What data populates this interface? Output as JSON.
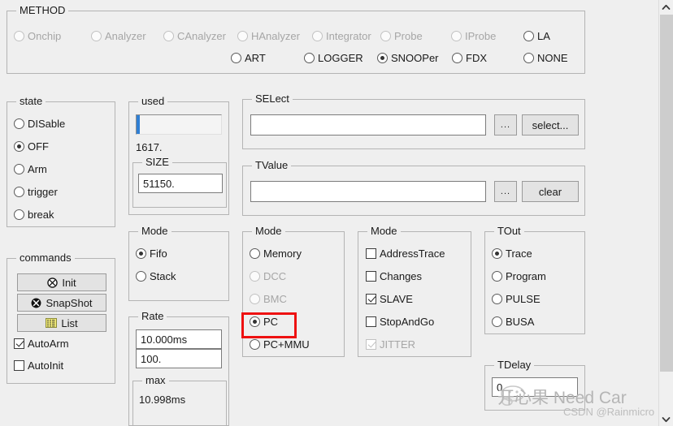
{
  "method": {
    "legend": "METHOD",
    "row1": [
      {
        "label": "Onchip",
        "checked": false,
        "disabled": true
      },
      {
        "label": "Analyzer",
        "checked": false,
        "disabled": true
      },
      {
        "label": "CAnalyzer",
        "checked": false,
        "disabled": true
      },
      {
        "label": "HAnalyzer",
        "checked": false,
        "disabled": true
      },
      {
        "label": "Integrator",
        "checked": false,
        "disabled": true
      },
      {
        "label": "Probe",
        "checked": false,
        "disabled": true
      },
      {
        "label": "IProbe",
        "checked": false,
        "disabled": true
      },
      {
        "label": "LA",
        "checked": false,
        "disabled": false
      }
    ],
    "row2": [
      {
        "label": "ART",
        "checked": false,
        "disabled": false
      },
      {
        "label": "LOGGER",
        "checked": false,
        "disabled": false
      },
      {
        "label": "SNOOPer",
        "checked": true,
        "disabled": false
      },
      {
        "label": "FDX",
        "checked": false,
        "disabled": false
      },
      {
        "label": "NONE",
        "checked": false,
        "disabled": false
      }
    ]
  },
  "state": {
    "legend": "state",
    "options": [
      {
        "label": "DISable",
        "checked": false
      },
      {
        "label": "OFF",
        "checked": true
      },
      {
        "label": "Arm",
        "checked": false
      },
      {
        "label": "trigger",
        "checked": false
      },
      {
        "label": "break",
        "checked": false
      }
    ]
  },
  "commands": {
    "legend": "commands",
    "buttons": [
      {
        "label": "Init",
        "icon": "circle-x-outline-icon"
      },
      {
        "label": "SnapShot",
        "icon": "circle-x-filled-icon"
      },
      {
        "label": "List",
        "icon": "list-grid-icon"
      }
    ],
    "checkboxes": [
      {
        "label": "AutoArm",
        "checked": true
      },
      {
        "label": "AutoInit",
        "checked": false
      }
    ]
  },
  "used": {
    "legend": "used",
    "percent": 3,
    "value": "1617."
  },
  "size": {
    "legend": "SIZE",
    "value": "51150."
  },
  "mode_fifo": {
    "legend": "Mode",
    "options": [
      {
        "label": "Fifo",
        "checked": true
      },
      {
        "label": "Stack",
        "checked": false
      }
    ]
  },
  "rate": {
    "legend": "Rate",
    "value1": "10.000ms",
    "value2": "100."
  },
  "max": {
    "legend": "max",
    "value": "10.998ms"
  },
  "select": {
    "legend": "SELect",
    "value": "",
    "placeholder": "",
    "dots_label": "...",
    "action_label": "select..."
  },
  "tvalue": {
    "legend": "TValue",
    "value": "",
    "placeholder": "",
    "dots_label": "...",
    "action_label": "clear"
  },
  "mode_pc": {
    "legend": "Mode",
    "options": [
      {
        "label": "Memory",
        "checked": false,
        "disabled": false
      },
      {
        "label": "DCC",
        "checked": false,
        "disabled": true
      },
      {
        "label": "BMC",
        "checked": false,
        "disabled": true
      },
      {
        "label": "PC",
        "checked": true,
        "disabled": false
      },
      {
        "label": "PC+MMU",
        "checked": false,
        "disabled": false
      }
    ],
    "highlight_index": 3,
    "highlight_color": "#ee1111"
  },
  "mode_trace": {
    "legend": "Mode",
    "options": [
      {
        "label": "AddressTrace",
        "checked": false,
        "disabled": false
      },
      {
        "label": "Changes",
        "checked": false,
        "disabled": false
      },
      {
        "label": "SLAVE",
        "checked": true,
        "disabled": false
      },
      {
        "label": "StopAndGo",
        "checked": false,
        "disabled": false
      },
      {
        "label": "JITTER",
        "checked": true,
        "disabled": true
      }
    ]
  },
  "tout": {
    "legend": "TOut",
    "options": [
      {
        "label": "Trace",
        "checked": true
      },
      {
        "label": "Program",
        "checked": false
      },
      {
        "label": "PULSE",
        "checked": false
      },
      {
        "label": "BUSA",
        "checked": false
      }
    ]
  },
  "tdelay": {
    "legend": "TDelay",
    "value": "0."
  },
  "scrollbar": {
    "up_arrow": "chevron-up-icon",
    "down_arrow": "chevron-down-icon"
  },
  "watermark": {
    "main": "开心果 Need Car",
    "sub": "CSDN @Rainmicro"
  },
  "colors": {
    "background": "#efefef",
    "accent_blue": "#2f7fd4",
    "highlight_red": "#ee1111",
    "scroll_thumb": "#cdcdcd"
  }
}
